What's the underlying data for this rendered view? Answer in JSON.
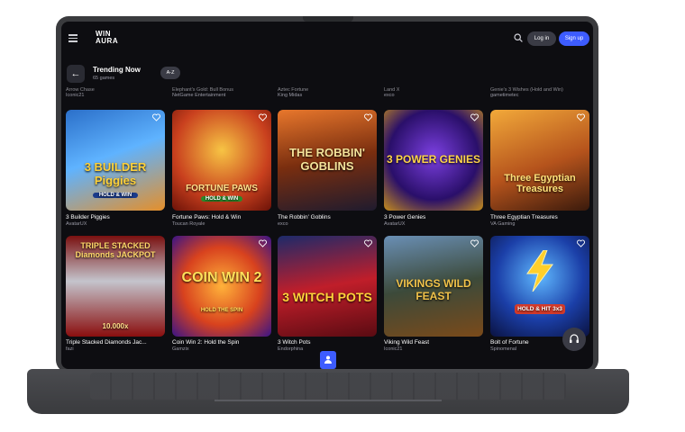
{
  "header": {
    "logo_line1": "WIN",
    "logo_line2": "AURA",
    "login_label": "Log in",
    "signup_label": "Sign up"
  },
  "section": {
    "title": "Trending Now",
    "count": "65 games",
    "sort_label": "A-Z"
  },
  "cut_row": [
    {
      "name": "Arrow Chase",
      "provider": "Iconic21"
    },
    {
      "name": "Elephant's Gold: Bull Bonus",
      "provider": "NetGame Entertainment"
    },
    {
      "name": "Aztec Fortune",
      "provider": "King Midas"
    },
    {
      "name": "Land X",
      "provider": "exco"
    },
    {
      "name": "Genie's 3 Wishes (Hold and Win)",
      "provider": "gametimetec"
    }
  ],
  "games": [
    {
      "name": "3 Builder Piggies",
      "provider": "AvatarUX",
      "art": "3 BUILDER Piggies",
      "badge": "HOLD & WIN"
    },
    {
      "name": "Fortune Paws: Hold & Win",
      "provider": "Toucan Royale",
      "art": "FORTUNE PAWS",
      "badge": "HOLD & WIN"
    },
    {
      "name": "The Robbin' Goblins",
      "provider": "exco",
      "art": "THE ROBBIN' GOBLINS"
    },
    {
      "name": "3 Power Genies",
      "provider": "AvatarUX",
      "art": "3 POWER GENIES"
    },
    {
      "name": "Three Egyptian Treasures",
      "provider": "VA Gaming",
      "art": "Three Egyptian Treasures"
    },
    {
      "name": "Triple Stacked Diamonds Jac...",
      "provider": "fazi",
      "art": "TRIPLE STACKED Diamonds JACKPOT",
      "badge": "10.000x"
    },
    {
      "name": "Coin Win 2: Hold the Spin",
      "provider": "Gamzix",
      "art": "COIN WIN 2",
      "badge": "HOLD THE SPIN"
    },
    {
      "name": "3 Witch Pots",
      "provider": "Endorphina",
      "art": "3 WITCH POTS"
    },
    {
      "name": "Viking Wild Feast",
      "provider": "Iconic21",
      "art": "VIKINGS WILD FEAST"
    },
    {
      "name": "Bolt of Fortune",
      "provider": "Spinomenal",
      "art": "HOLD & HIT 3x3"
    }
  ],
  "colors": {
    "accent": "#3d5cff",
    "background": "#0d0d11"
  }
}
